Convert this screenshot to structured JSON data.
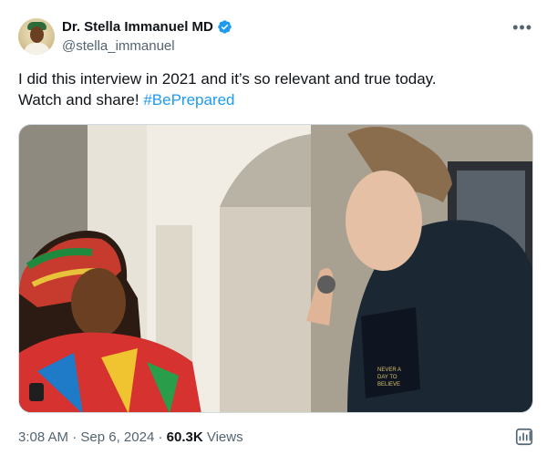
{
  "author": {
    "name": "Dr. Stella Immanuel MD",
    "handle": "@stella_immanuel"
  },
  "tweet": {
    "line1": "I did this interview in 2021 and it’s so relevant and true today.",
    "line2_prefix": "Watch and share! ",
    "hashtag": "#BePrepared"
  },
  "meta": {
    "time": "3:08 AM",
    "sep1": " · ",
    "date": "Sep 6, 2024",
    "sep2": " · ",
    "views_count": "60.3K",
    "views_label": " Views"
  },
  "shirt_text": "NEVER A DAY TO BELIEVE IN TRUTH",
  "colors": {
    "accent": "#1d9bf0",
    "muted": "#536471",
    "text": "#0f1419"
  }
}
